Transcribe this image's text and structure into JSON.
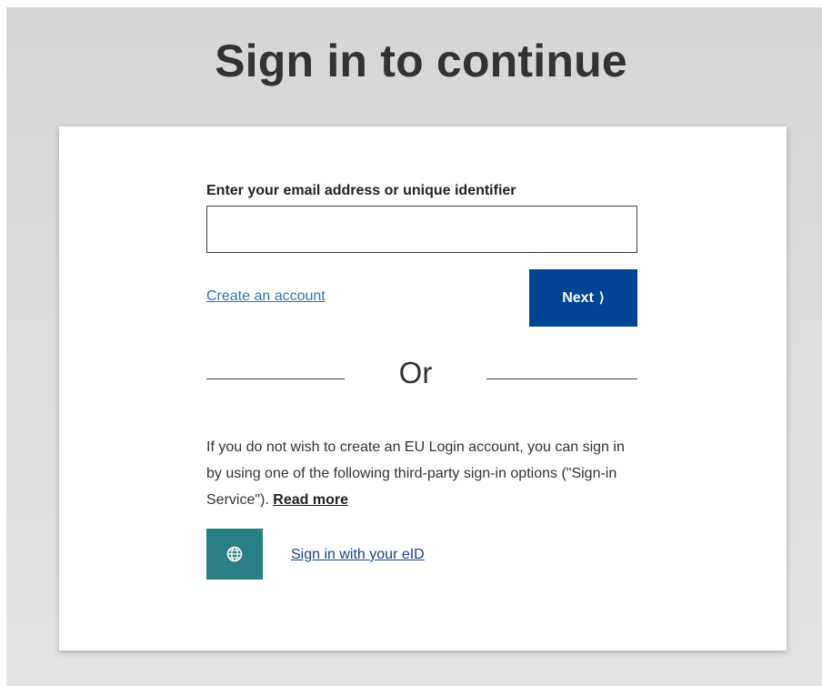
{
  "page": {
    "title": "Sign in to continue"
  },
  "form": {
    "email_label": "Enter your email address or unique identifier",
    "email_value": "",
    "create_account_link": "Create an account",
    "next_button": "Next",
    "next_chevron": "⟩"
  },
  "divider": {
    "or_text": "Or"
  },
  "third_party": {
    "info_text": "If you do not wish to create an EU Login account, you can sign in by using one of the following third-party sign-in options (\"Sign-in Service\").",
    "read_more": "Read more",
    "eid_icon": "globe-icon",
    "eid_link": "Sign in with your eID"
  },
  "colors": {
    "primary_button": "#004494",
    "eid_button": "#2a7f85",
    "link": "#2e74b5",
    "eid_link": "#1a3f8c"
  }
}
